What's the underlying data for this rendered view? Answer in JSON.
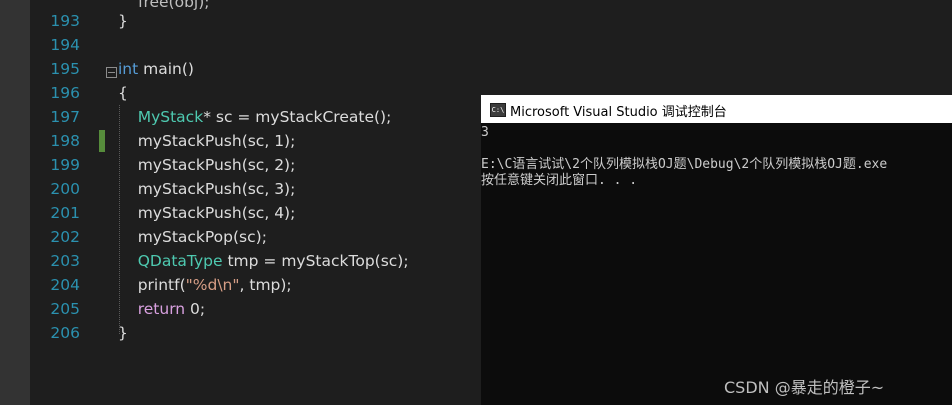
{
  "editor": {
    "line_numbers": [
      "193",
      "194",
      "195",
      "196",
      "197",
      "198",
      "199",
      "200",
      "201",
      "202",
      "203",
      "204",
      "205",
      "206"
    ],
    "lines": [
      {
        "parts": [
          {
            "t": "}",
            "c": "plain"
          }
        ]
      },
      {
        "parts": []
      },
      {
        "parts": [
          {
            "t": "int",
            "c": "kw"
          },
          {
            "t": " main()",
            "c": "plain"
          }
        ]
      },
      {
        "parts": [
          {
            "t": "{",
            "c": "plain"
          }
        ]
      },
      {
        "parts": [
          {
            "t": "    ",
            "c": "plain"
          },
          {
            "t": "MyStack",
            "c": "ty"
          },
          {
            "t": "* sc = myStackCreate();",
            "c": "plain"
          }
        ]
      },
      {
        "parts": [
          {
            "t": "    myStackPush(sc, 1);",
            "c": "plain"
          }
        ]
      },
      {
        "parts": [
          {
            "t": "    myStackPush(sc, 2);",
            "c": "plain"
          }
        ]
      },
      {
        "parts": [
          {
            "t": "    myStackPush(sc, 3);",
            "c": "plain"
          }
        ]
      },
      {
        "parts": [
          {
            "t": "    myStackPush(sc, 4);",
            "c": "plain"
          }
        ]
      },
      {
        "parts": [
          {
            "t": "    myStackPop(sc);",
            "c": "plain"
          }
        ]
      },
      {
        "parts": [
          {
            "t": "    ",
            "c": "plain"
          },
          {
            "t": "QDataType",
            "c": "ty"
          },
          {
            "t": " tmp = myStackTop(sc);",
            "c": "plain"
          }
        ]
      },
      {
        "parts": [
          {
            "t": "    printf(",
            "c": "plain"
          },
          {
            "t": "\"%d\\n\"",
            "c": "str"
          },
          {
            "t": ", tmp);",
            "c": "plain"
          }
        ]
      },
      {
        "parts": [
          {
            "t": "    ",
            "c": "plain"
          },
          {
            "t": "return",
            "c": "ctl"
          },
          {
            "t": " 0;",
            "c": "plain"
          }
        ]
      },
      {
        "parts": [
          {
            "t": "}",
            "c": "plain"
          }
        ]
      }
    ],
    "partial_top_line": "free(obj);"
  },
  "console": {
    "title": "Microsoft Visual Studio 调试控制台",
    "icon_label": "C:\\",
    "output": [
      "3",
      "",
      "E:\\C语言试试\\2个队列模拟栈OJ题\\Debug\\2个队列模拟栈OJ题.exe",
      "按任意键关闭此窗口. . ."
    ]
  },
  "watermark": "CSDN @暴走的橙子~"
}
